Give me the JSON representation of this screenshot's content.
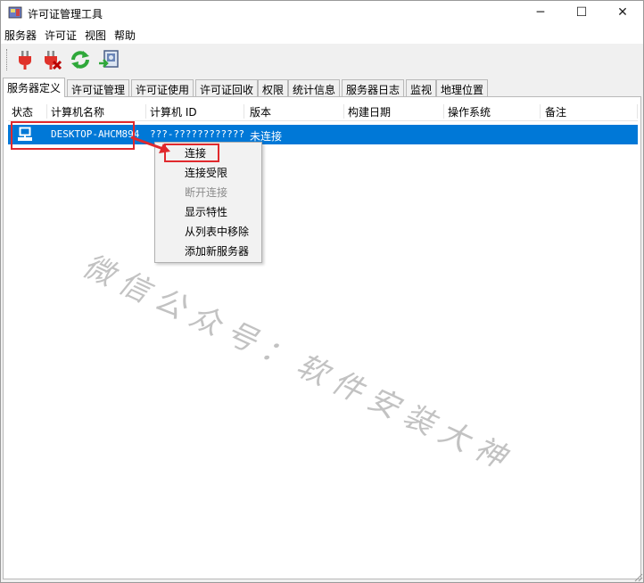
{
  "window": {
    "title": "许可证管理工具",
    "minimize_glyph": "─",
    "maximize_glyph": "☐",
    "close_glyph": "✕"
  },
  "menu": [
    "服务器",
    "许可证",
    "视图",
    "帮助"
  ],
  "toolbar": {
    "buttons": [
      "connect-plug-icon",
      "disconnect-plug-icon",
      "refresh-icon",
      "export-icon"
    ]
  },
  "tabs": [
    "服务器定义",
    "许可证管理",
    "许可证使用",
    "许可证回收",
    "权限",
    "统计信息",
    "服务器日志",
    "监视",
    "地理位置"
  ],
  "active_tab": 0,
  "table": {
    "columns": [
      "状态",
      "计算机名称",
      "计算机 ID",
      "版本",
      "构建日期",
      "操作系统",
      "备注"
    ],
    "rows": [
      {
        "status_icon": "computer-icon",
        "computer_name": "DESKTOP-AHCM894",
        "computer_id": "???-????????????????",
        "version": "未连接",
        "build_date": "",
        "os": "",
        "notes": ""
      }
    ]
  },
  "context_menu": {
    "items": [
      {
        "label": "连接",
        "enabled": true,
        "highlighted": true
      },
      {
        "label": "连接受限",
        "enabled": true
      },
      {
        "label": "断开连接",
        "enabled": false
      },
      {
        "label": "显示特性",
        "enabled": true
      },
      {
        "label": "从列表中移除",
        "enabled": true
      },
      {
        "label": "添加新服务器",
        "enabled": true
      }
    ]
  },
  "watermark": "微信公众号：软件安装大神",
  "colors": {
    "selection": "#0078d7",
    "highlight_red": "#e0292d"
  }
}
